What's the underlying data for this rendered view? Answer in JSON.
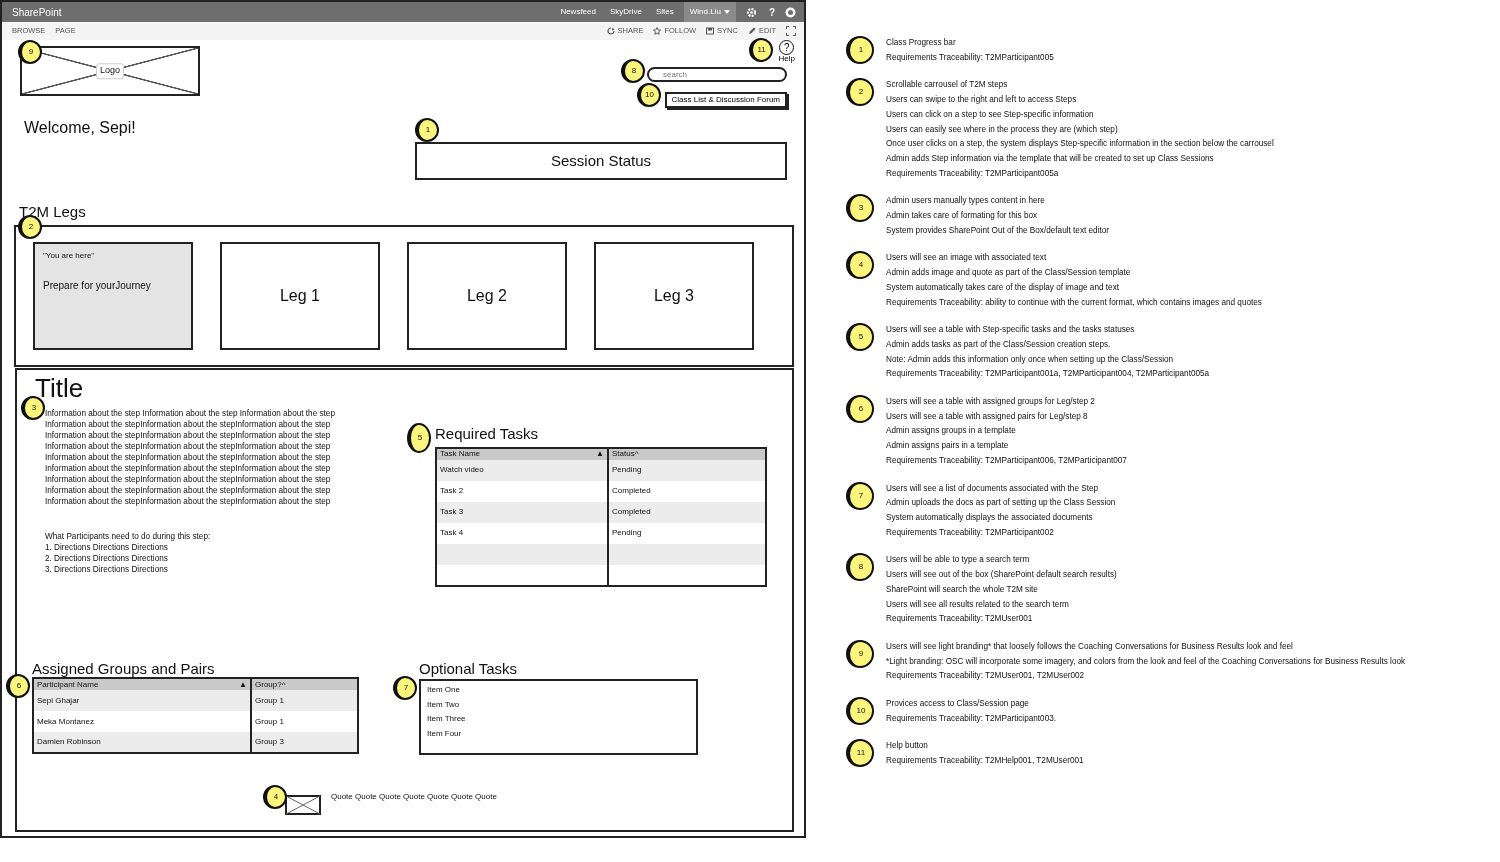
{
  "topbar": {
    "brand": "SharePoint",
    "links": [
      "Newsfeed",
      "SkyDrive",
      "Sites"
    ],
    "user": "Wind.Liu",
    "help_glyph": "?"
  },
  "ribbon": {
    "tabs": [
      "BROWSE",
      "PAGE"
    ],
    "actions": [
      {
        "kind": "share",
        "label": "SHARE"
      },
      {
        "kind": "follow",
        "label": "FOLLOW"
      },
      {
        "kind": "sync",
        "label": "SYNC"
      },
      {
        "kind": "edit",
        "label": "EDIT"
      }
    ]
  },
  "logo": {
    "label": "Logo",
    "callout": "9"
  },
  "help": {
    "glyph": "?",
    "label": "Help",
    "callout": "11"
  },
  "search": {
    "placeholder": "search",
    "callout": "8"
  },
  "class_link": {
    "label": "Class List & Discussion Forum",
    "callout": "10"
  },
  "welcome": "Welcome, Sepi!",
  "session_status": {
    "label": "Session Status",
    "callout": "1"
  },
  "legs": {
    "heading": "T2M Legs",
    "callout": "2",
    "items": [
      {
        "caption": "\"You are here\"",
        "label": "Prepare for yourJourney",
        "selected": true
      },
      {
        "label": "Leg 1",
        "selected": false
      },
      {
        "label": "Leg 2",
        "selected": false
      },
      {
        "label": "Leg 3",
        "selected": false
      }
    ]
  },
  "step": {
    "title": "Title",
    "callout": "3",
    "info_lines": [
      "Information about the step  Information about the step Information about the step",
      "Information about the stepInformation about the stepInformation about the step",
      "Information about the stepInformation about the stepInformation about the step",
      "Information about the stepInformation about the stepInformation about the step",
      "Information about the stepInformation about the stepInformation about the step",
      "Information about the stepInformation about the stepInformation about the step",
      "Information about the stepInformation about the stepInformation about the step",
      "Information about the stepInformation about the stepInformation about the step",
      "Information about the stepInformation about the stepInformation about the step"
    ],
    "directions_heading": "What Participants need to do during this step:",
    "directions": [
      "1. Directions Directions Directions",
      "2. Directions Directions Directions",
      "3. Directions Directions Directions"
    ]
  },
  "required_tasks": {
    "heading": "Required Tasks",
    "callout": "5",
    "columns": [
      {
        "label": "Task Name",
        "sort_glyph": "▲"
      },
      {
        "label": "Status^"
      }
    ],
    "rows": [
      [
        "Watch video",
        "Pending"
      ],
      [
        "Task 2",
        "Completed"
      ],
      [
        "Task 3",
        "Completed"
      ],
      [
        "Task 4",
        "Pending"
      ]
    ]
  },
  "assigned_groups": {
    "heading": "Assigned Groups and Pairs",
    "callout": "6",
    "columns": [
      {
        "label": "Participant Name",
        "sort_glyph": "▲"
      },
      {
        "label": "Group?^"
      }
    ],
    "rows": [
      [
        "Sepi Ghajar",
        "Group 1"
      ],
      [
        "Meka Montanez",
        "Group 1"
      ],
      [
        "Damien Robinson",
        "Group 3"
      ]
    ]
  },
  "optional_tasks": {
    "heading": "Optional Tasks",
    "callout": "7",
    "items": [
      "Item One",
      "Item Two",
      "Item Three",
      "Item Four"
    ]
  },
  "quote": {
    "callout": "4",
    "text": "Quote Quote Quote Quote Quote Quote Quote"
  },
  "notes": [
    {
      "number": "1",
      "lines": [
        "Class Progress bar",
        "Requirements Traceability: T2MParticipant005"
      ]
    },
    {
      "number": "2",
      "lines": [
        "Scrollable carrousel of T2M steps",
        "Users can swipe to the right and left to access Steps",
        "Users can click on a step to see Step-specific information",
        "Users can easily see where in the process they are (which step)",
        "Once user clicks on a step, the system displays Step-specific information in the section below the carrousel",
        "Admin adds Step information via the template that will be created to set up Class Sessions",
        "Requirements Traceability: T2MParticipant005a"
      ]
    },
    {
      "number": "3",
      "lines": [
        "Admin users manually types content in here",
        "Admin takes care of formating for this box",
        "System provides SharePoint Out of the Box/default text editor"
      ]
    },
    {
      "number": "4",
      "lines": [
        "Users will see an image with associated text",
        "Admin adds image and quote as part of the Class/Session template",
        "System automatically takes care of the display of image and text",
        "Requirements Traceability: ability to continue with the current format, which contains images and quotes"
      ]
    },
    {
      "number": "5",
      "lines": [
        "Users will see a table with Step-specific tasks and the tasks statuses",
        "Admin adds tasks as part of the Class/Session creation steps.",
        "Note: Admin adds this information only once when setting up the Class/Session",
        "Requirements Traceability: T2MParticipant001a, T2MParticipant004, T2MParticipant005a"
      ]
    },
    {
      "number": "6",
      "lines": [
        "Users will see a table with assigned groups for Leg/step 2",
        "Users will see a table with assigned pairs for Leg/step 8",
        "Admin assigns groups in a template",
        "Admin assigns pairs in a template",
        "Requirements Traceability: T2MParticipant006, T2MParticipant007"
      ]
    },
    {
      "number": "7",
      "lines": [
        "Users will see a list of documents associated with the Step",
        "Admin uploads the docs as part of setting up the Class Session",
        "System automatically displays the associated documents",
        "Requirements Traceability: T2MParticipant002"
      ]
    },
    {
      "number": "8",
      "lines": [
        "Users will be able to type a search term",
        "Users will see out of the box (SharePoint default search results)",
        "SharePoint will search the whole T2M site",
        "Users will see all results related to the search term",
        "Requirements Traceability: T2MUser001"
      ]
    },
    {
      "number": "9",
      "lines": [
        "Users will see light branding* that  loosely follows the Coaching Conversations for Business Results look and feel",
        "*Light branding:  OSC will incorporate some imagery, and colors from the look and feel of the Coaching Conversations for Business Results look",
        "Requirements Traceability: T2MUser001, T2MUser002"
      ]
    },
    {
      "number": "10",
      "lines": [
        "Provices access to Class/Session page",
        "Requirements Traceability: T2MParticipant003."
      ]
    },
    {
      "number": "11",
      "lines": [
        "Help button",
        "Requirements Traceability: T2MHelp001, T2MUser001"
      ]
    }
  ]
}
